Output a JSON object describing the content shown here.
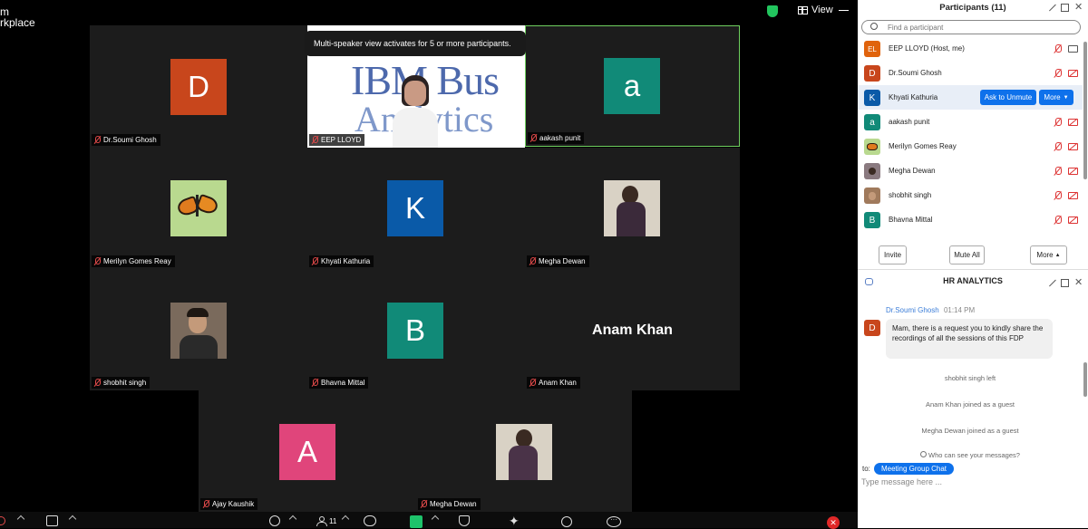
{
  "app": {
    "title_line1": "m",
    "title_line2": "rkplace"
  },
  "topbar": {
    "view_label": "View"
  },
  "banner": {
    "text": "Multi-speaker view activates for 5 or more participants."
  },
  "video_tiles": [
    {
      "name": "Dr.Soumi Ghosh",
      "initial": "D",
      "color": "#c8461c"
    },
    {
      "name": "EEP LLOYD",
      "initial": "",
      "color": ""
    },
    {
      "name": "aakash punit",
      "initial": "a",
      "color": "#118a78"
    },
    {
      "name": "Merilyn Gomes Reay",
      "initial": "",
      "color": ""
    },
    {
      "name": "Khyati Kathuria",
      "initial": "K",
      "color": "#0a5aa8"
    },
    {
      "name": "Megha Dewan",
      "initial": "",
      "color": ""
    },
    {
      "name": "shobhit singh",
      "initial": "",
      "color": ""
    },
    {
      "name": "Bhavna Mittal",
      "initial": "B",
      "color": "#118a78"
    },
    {
      "name": "Anam Khan",
      "initial": "Anam Khan",
      "color": ""
    },
    {
      "name": "Ajay Kaushik",
      "initial": "A",
      "color": "#e0457b"
    },
    {
      "name": "Megha Dewan",
      "initial": "",
      "color": ""
    }
  ],
  "presentation": {
    "line1": "IBM Bus",
    "line2": "Analytics"
  },
  "toolbar": {
    "participants_count": "11"
  },
  "participants_panel": {
    "title": "Participants (11)",
    "search_placeholder": "Find a participant",
    "participants": [
      {
        "name": "EEP LLOYD (Host, me)",
        "initials": "EL",
        "color": "#e0630c"
      },
      {
        "name": "Dr.Soumi Ghosh",
        "initials": "D",
        "color": "#c8461c"
      },
      {
        "name": "Khyati Kathuria",
        "initials": "K",
        "color": "#0a5aa8"
      },
      {
        "name": "aakash punit",
        "initials": "a",
        "color": "#118a78"
      },
      {
        "name": "Merilyn Gomes Reay",
        "initials": "",
        "color": ""
      },
      {
        "name": "Megha Dewan",
        "initials": "",
        "color": ""
      },
      {
        "name": "shobhit singh",
        "initials": "",
        "color": ""
      },
      {
        "name": "Bhavna Mittal",
        "initials": "B",
        "color": "#118a78"
      }
    ],
    "ask_to_unmute": "Ask to Unmute",
    "more_row": "More",
    "invite": "Invite",
    "mute_all": "Mute All",
    "more": "More"
  },
  "chat": {
    "title": "HR ANALYTICS",
    "message": {
      "sender": "Dr.Soumi Ghosh",
      "time": "01:14 PM",
      "initial": "D",
      "text": "Mam, there is a request you to kindly share the recordings of all the sessions of this FDP"
    },
    "system_messages": [
      "shobhit singh left",
      "Anam Khan joined as a guest",
      "Megha Dewan joined as a guest"
    ],
    "who_can_see": "Who can see your messages?",
    "to_label": "to:",
    "recipient": "Meeting Group Chat",
    "input_placeholder": "Type message here ..."
  }
}
